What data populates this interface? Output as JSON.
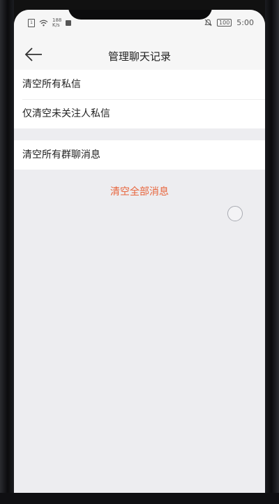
{
  "status_bar": {
    "net_speed_value": "188",
    "net_speed_unit": "K/s",
    "battery": "100",
    "time": "5:00"
  },
  "nav": {
    "title": "管理聊天记录",
    "back_icon": "arrow-left-icon"
  },
  "sections": {
    "private": [
      "清空所有私信",
      "仅清空未关注人私信"
    ],
    "group": [
      "清空所有群聊消息"
    ]
  },
  "danger_action": {
    "label": "清空全部消息",
    "color": "#e8653c"
  },
  "colors": {
    "background": "#ededf0",
    "card": "#ffffff",
    "text": "#222222"
  }
}
